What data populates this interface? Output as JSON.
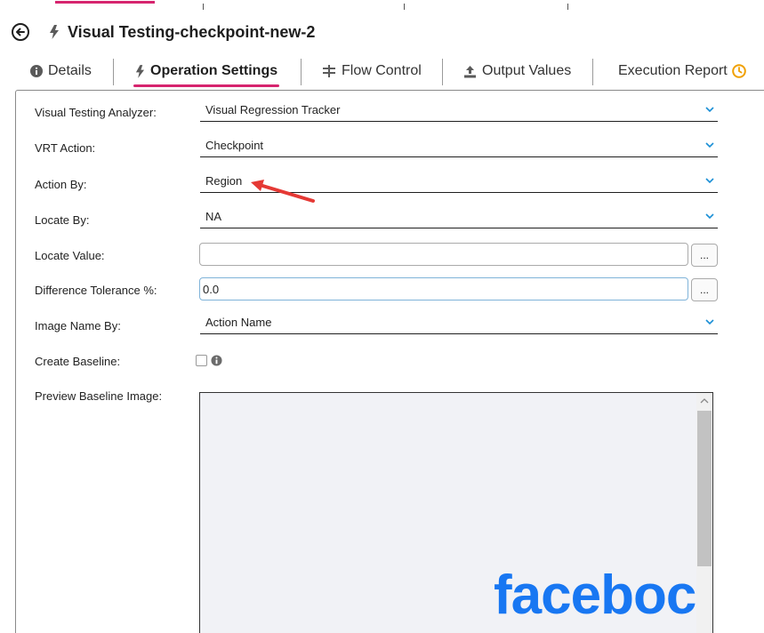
{
  "colors": {
    "accent": "#d6246e",
    "clock_orange": "#f0a000",
    "facebook_blue": "#1877f2",
    "annotation_red": "#e53935"
  },
  "header": {
    "back_icon": "circle-arrow-left-icon",
    "title_icon": "bolt-icon",
    "title": "Visual Testing-checkpoint-new-2"
  },
  "tabs": [
    {
      "label": "Details",
      "icon": "info-circle-icon",
      "active": false
    },
    {
      "label": "Operation Settings",
      "icon": "bolt-icon",
      "active": true
    },
    {
      "label": "Flow Control",
      "icon": "signpost-icon",
      "active": false
    },
    {
      "label": "Output Values",
      "icon": "upload-icon",
      "active": false
    },
    {
      "label": "Execution Report",
      "icon": "clock-icon",
      "active": false
    }
  ],
  "form": {
    "analyzer": {
      "label": "Visual Testing Analyzer:",
      "value": "Visual Regression Tracker"
    },
    "vrt_action": {
      "label": "VRT Action:",
      "value": "Checkpoint"
    },
    "action_by": {
      "label": "Action By:",
      "value": "Region"
    },
    "locate_by": {
      "label": "Locate By:",
      "value": "NA"
    },
    "locate_value": {
      "label": "Locate Value:",
      "value": "",
      "button": "..."
    },
    "difference_tolerance": {
      "label": "Difference Tolerance %:",
      "value": "0.0",
      "button": "..."
    },
    "image_name_by": {
      "label": "Image Name By:",
      "value": "Action Name"
    },
    "create_baseline": {
      "label": "Create Baseline:",
      "checked": false
    },
    "preview_baseline": {
      "label": "Preview Baseline Image:",
      "image_text": "faceboc"
    }
  }
}
